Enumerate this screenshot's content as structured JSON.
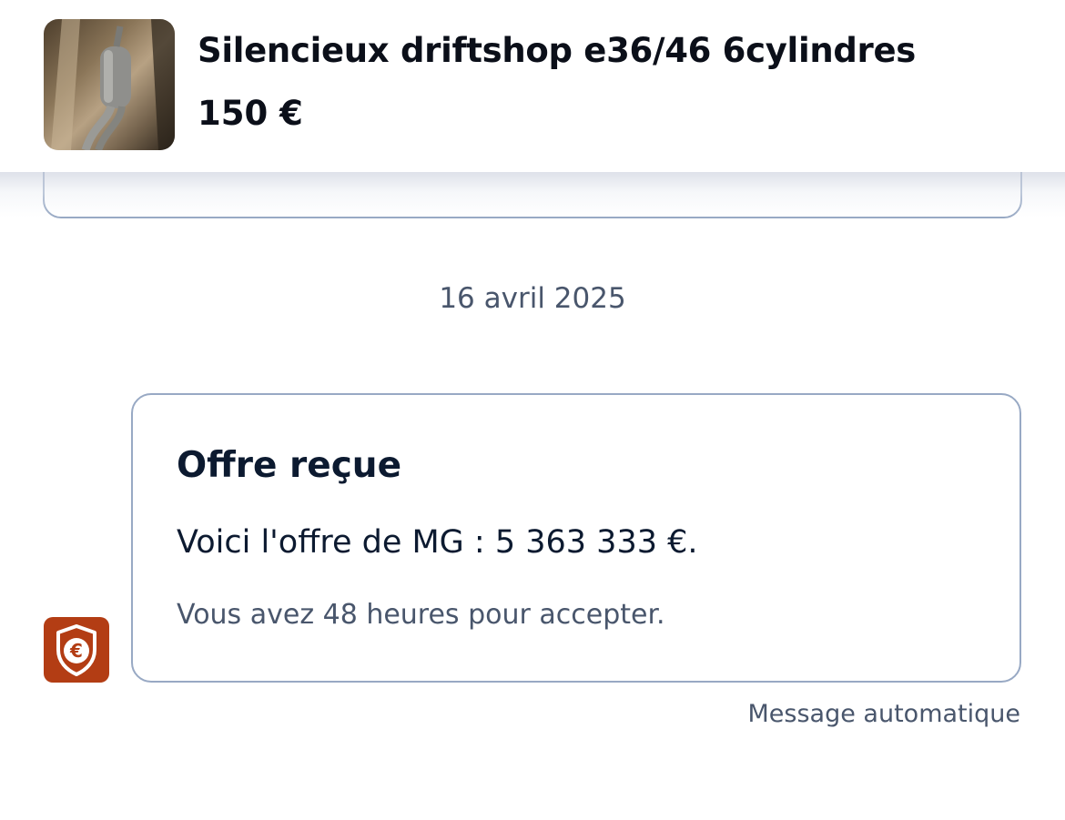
{
  "listing": {
    "title": "Silencieux driftshop e36/46 6cylindres",
    "price": "150 €",
    "thumbnail": "listing-photo"
  },
  "conversation": {
    "date_separator": "16 avril 2025",
    "offer": {
      "title": "Offre reçue",
      "text": "Voici l'offre de MG : 5 363 333 €.",
      "subtext": "Vous avez 48 heures pour accepter."
    },
    "avatar_icon": "euro-shield-icon",
    "auto_label": "Message automatique"
  },
  "colors": {
    "avatar_bg": "#b33d14",
    "card_border": "#98a9c4",
    "muted_text": "#49566c",
    "primary_text": "#0c1a30"
  }
}
